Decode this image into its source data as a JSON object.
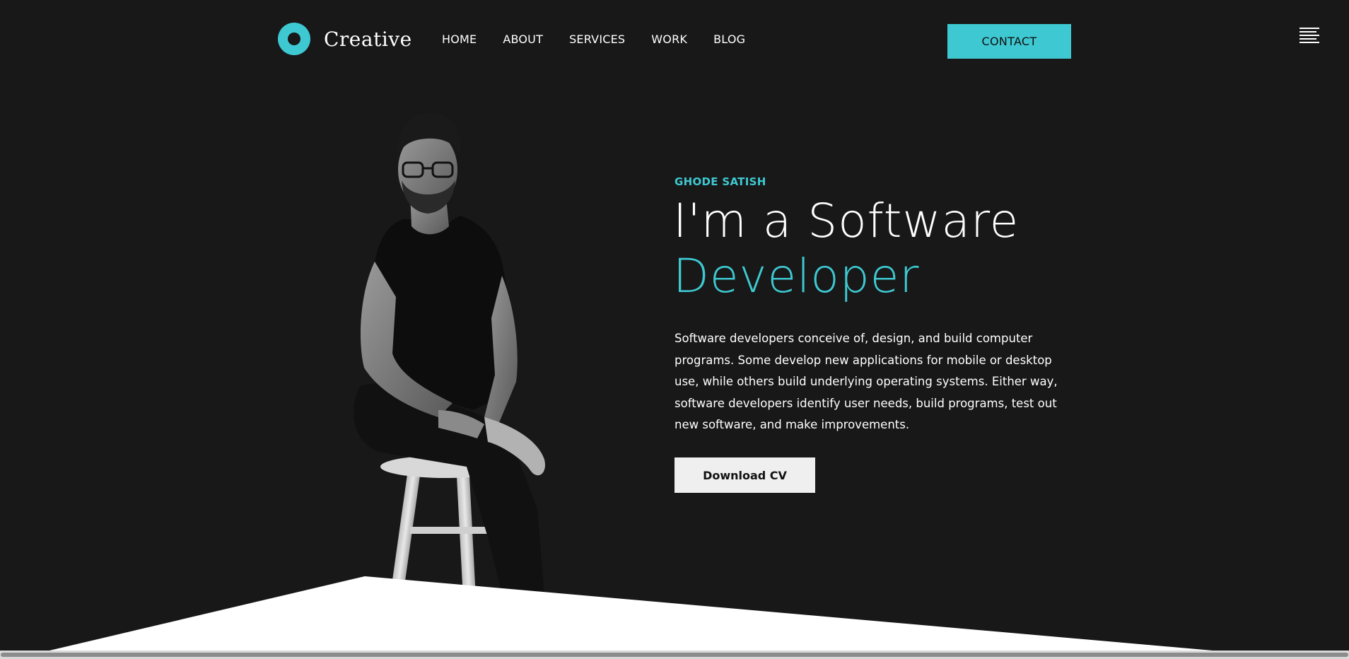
{
  "header": {
    "logo_text": "Creative",
    "nav": [
      {
        "label": "HOME"
      },
      {
        "label": "ABOUT"
      },
      {
        "label": "SERVICES"
      },
      {
        "label": "WORK"
      },
      {
        "label": "BLOG"
      }
    ],
    "contact_label": "CONTACT",
    "menu_icon": "hamburger-menu-icon"
  },
  "hero": {
    "eyebrow": "GHODE SATISH",
    "headline_lead": "I'm a Software",
    "headline_accent": "Developer",
    "description": "Software developers conceive of, design, and build computer programs. Some develop new applications for mobile or desktop use, while others build underlying operating systems. Either way, software developers identify user needs, build programs, test out new software, and make improvements.",
    "cv_button_label": "Download CV"
  },
  "colors": {
    "background": "#181818",
    "accent": "#3ec9d2",
    "text": "#ffffff",
    "button_light": "#efefef"
  }
}
